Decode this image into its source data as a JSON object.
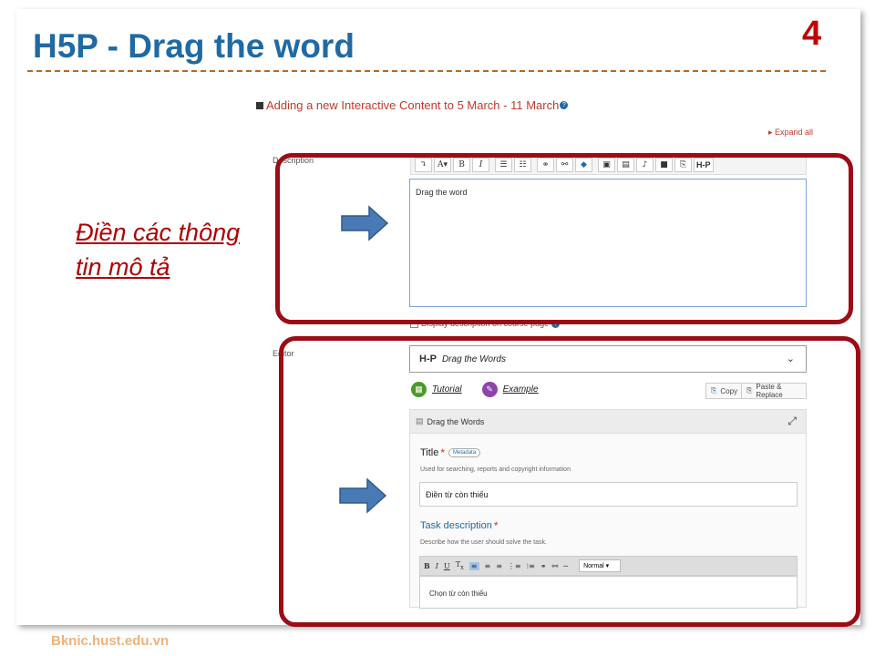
{
  "slide": {
    "title": "H5P - Drag the word",
    "number": "4",
    "footer": "Bknic.hust.edu.vn",
    "note_line1": "Điền các thông",
    "note_line2": "tin mô tả"
  },
  "colors": {
    "title": "#1f6aa5",
    "number": "#c00000",
    "highlight_box": "#9b0d16",
    "arrow": "#4a7ab5"
  },
  "form": {
    "heading": "Adding a new Interactive Content to 5 March - 11 March",
    "expand_all": "Expand all",
    "description_label": "Description",
    "description_value": "Drag the word",
    "display_description": "Display description on course page",
    "editor_label": "Editor",
    "toolbar_icons": [
      "undo-icon",
      "font-size-icon",
      "bold-icon",
      "italic-icon",
      "bullet-list-icon",
      "numbered-list-icon",
      "link-icon",
      "unlink-icon",
      "emoji-icon",
      "image-icon",
      "media-icon",
      "audio-icon",
      "video-icon",
      "copy-icon",
      "h5p-icon"
    ],
    "toolbar_labels": [
      "↴",
      "A▾",
      "B",
      "I",
      "☰",
      "☷",
      "⚭",
      "⚯",
      "◆",
      "▣",
      "▤",
      "♪",
      "■",
      "⎘",
      "H-P"
    ]
  },
  "h5p": {
    "logo": "H-P",
    "content_type": "Drag the Words",
    "tutorial": "Tutorial",
    "example": "Example",
    "copy": "Copy",
    "paste_replace": "Paste & Replace",
    "panel_title": "Drag the Words",
    "title_label": "Title",
    "metadata": "Metadata",
    "title_hint": "Used for searching, reports and copyright information",
    "title_value": "Điền từ còn thiếu",
    "task_label": "Task description",
    "task_hint": "Describe how the user should solve the task.",
    "task_value": "Chọn từ còn thiếu",
    "format_select": "Normal"
  }
}
